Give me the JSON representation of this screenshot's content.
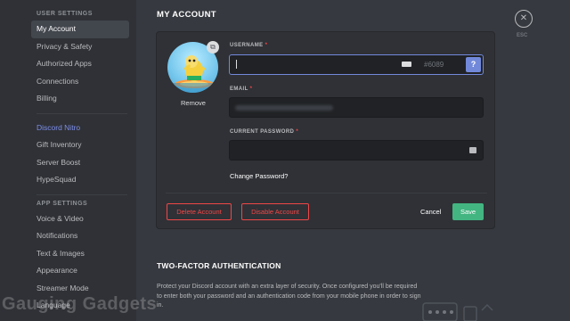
{
  "sidebar": {
    "sections": [
      {
        "header": "User Settings",
        "items": [
          {
            "label": "My Account",
            "selected": true
          },
          {
            "label": "Privacy & Safety"
          },
          {
            "label": "Authorized Apps"
          },
          {
            "label": "Connections"
          },
          {
            "label": "Billing"
          }
        ]
      },
      {
        "items": [
          {
            "label": "Discord Nitro",
            "accent": true
          },
          {
            "label": "Gift Inventory"
          },
          {
            "label": "Server Boost"
          },
          {
            "label": "HypeSquad"
          }
        ]
      },
      {
        "header": "App Settings",
        "items": [
          {
            "label": "Voice & Video"
          },
          {
            "label": "Notifications"
          },
          {
            "label": "Text & Images"
          },
          {
            "label": "Appearance"
          },
          {
            "label": "Streamer Mode"
          },
          {
            "label": "Language"
          }
        ]
      }
    ]
  },
  "watermark": "Gauging Gadgets",
  "main": {
    "title": "MY ACCOUNT",
    "close": {
      "glyph": "✕",
      "label": "ESC"
    },
    "avatar": {
      "remove_label": "Remove",
      "edit_icon": "image-edit-icon"
    },
    "username": {
      "label": "USERNAME",
      "required": "*",
      "value": "",
      "discriminator": "#6089",
      "help_glyph": "?"
    },
    "email": {
      "label": "EMAIL",
      "required": "*",
      "value_hidden": true
    },
    "password": {
      "label": "CURRENT PASSWORD",
      "required": "*",
      "value": ""
    },
    "change_password": "Change Password?",
    "delete_account": "Delete Account",
    "disable_account": "Disable Account",
    "cancel": "Cancel",
    "save": "Save",
    "two_factor": {
      "title": "TWO-FACTOR AUTHENTICATION",
      "description": "Protect your Discord account with an extra layer of security. Once configured you'll be required to enter both your password and an authentication code from your mobile phone in order to sign in."
    }
  },
  "colors": {
    "background": "#36393f",
    "sidebar": "#2f3136",
    "accent": "#7289da",
    "danger": "#f04747",
    "success": "#43b581",
    "nitro": "#7d8ee9"
  }
}
